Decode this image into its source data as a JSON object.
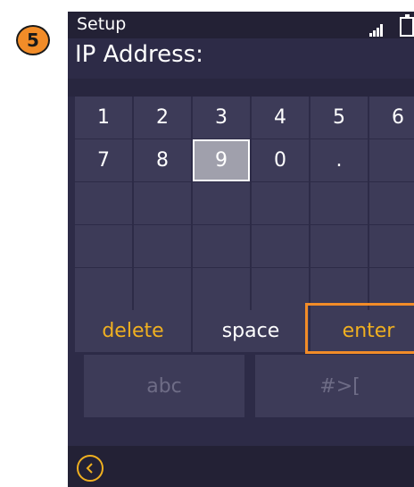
{
  "step_badge": "5",
  "status": {
    "title": "Setup"
  },
  "field": {
    "label": "IP Address:"
  },
  "keypad": {
    "rows": [
      [
        "1",
        "2",
        "3",
        "4",
        "5",
        "6"
      ],
      [
        "7",
        "8",
        "9",
        "0",
        ".",
        ""
      ],
      [
        "",
        "",
        "",
        "",
        "",
        ""
      ],
      [
        "",
        "",
        "",
        "",
        "",
        ""
      ],
      [
        "",
        "",
        "",
        "",
        "",
        ""
      ]
    ],
    "selected_key": "9"
  },
  "actions": {
    "delete": "delete",
    "space": "space",
    "enter": "enter"
  },
  "modes": {
    "abc": "abc",
    "symbols": "#>["
  },
  "colors": {
    "accent": "#f28c28",
    "highlight_text": "#f0b020",
    "screen_bg": "#2d2b47",
    "key_bg": "#3d3b58"
  },
  "icons": {
    "signal": "signal-icon",
    "battery": "battery-icon",
    "back": "back-arrow-icon"
  }
}
